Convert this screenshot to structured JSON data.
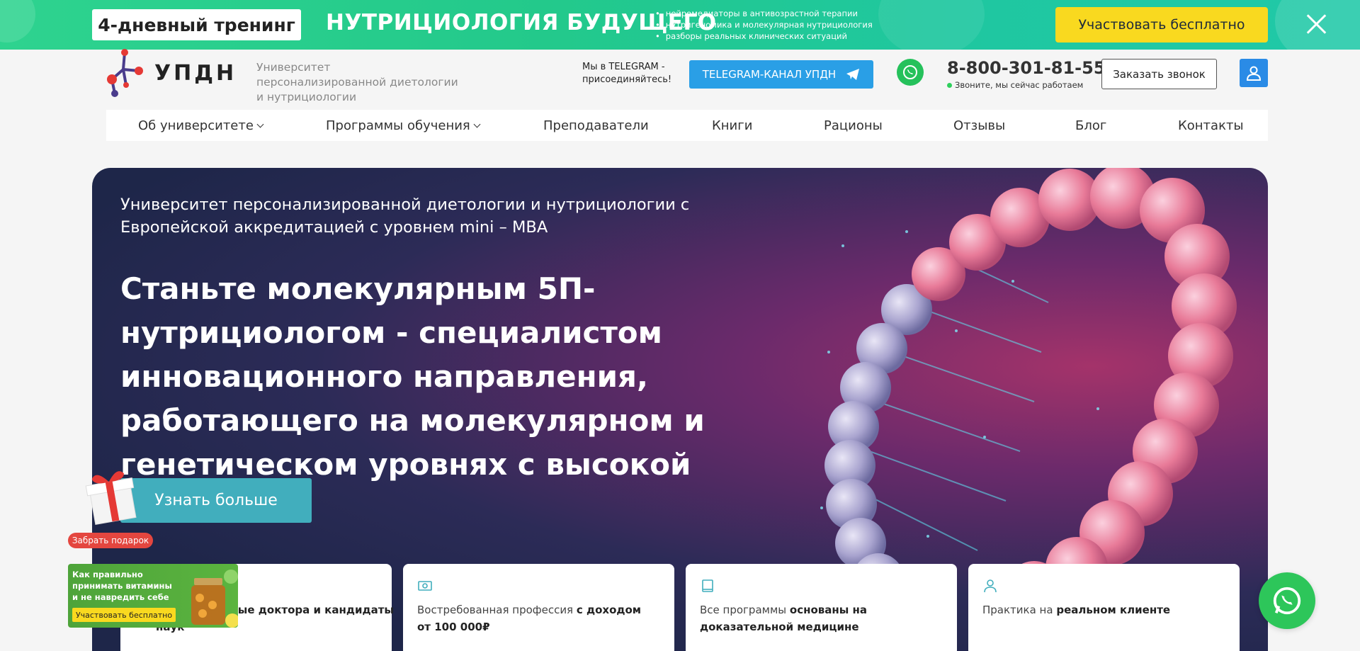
{
  "promo": {
    "pill_label": "4-дневный тренинг",
    "title": "НУТРИЦИОЛОГИЯ БУДУЩЕГО",
    "bullets": [
      "нейромедиаторы в антивозрастной терапии",
      "нутригеномика и молекулярная нутрициология",
      "разборы реальных клинических ситуаций"
    ],
    "cta_label": "Участвовать бесплатно",
    "accent": "#23c98b",
    "cta_color": "#f9d91f"
  },
  "header": {
    "logo_text": "УПДН",
    "tagline": "Университет персонализированной диетологии и нутрициологии",
    "telegram_label": "Мы в TELEGRAM - присоединяйтесь!",
    "telegram_button": "TELEGRAM-КАНАЛ УПДН",
    "phone": "8-800-301-81-55",
    "phone_status": "Звоните, мы сейчас работаем",
    "call_button": "Заказать звонок"
  },
  "nav": {
    "items": [
      {
        "label": "Об университете"
      },
      {
        "label": "Программы обучения"
      },
      {
        "label": "Преподаватели"
      },
      {
        "label": "Книги"
      },
      {
        "label": "Рационы"
      },
      {
        "label": "Отзывы"
      },
      {
        "label": "Блог"
      },
      {
        "label": "Контакты"
      }
    ]
  },
  "hero": {
    "subtitle": "Университет персонализированной диетологии и нутрициологии с Европейской аккредитацией с уровнем mini – MBA",
    "title": "Станьте молекулярным 5П-нутрициологом - специалистом инновационного направления, работающего на молекулярном и генетическом уровнях с высокой точностью",
    "cta_label": "Узнать больше"
  },
  "features": [
    {
      "plain": "",
      "bold": "пломированные доктора и кандидаты наук",
      "icon": "diploma-icon"
    },
    {
      "plain": "Востребованная профессия ",
      "bold": "с доходом от 100 000₽",
      "icon": "money-icon"
    },
    {
      "plain": "Все программы ",
      "bold": "основаны на доказательной медицине",
      "icon": "book-icon"
    },
    {
      "plain": "Практика на ",
      "bold": "реальном клиенте",
      "icon": "user-icon"
    }
  ],
  "gift": {
    "label": "Забрать подарок"
  },
  "vitamin_widget": {
    "text": "Как правильно принимать витамины и не навредить себе",
    "button": "Участвовать бесплатно"
  }
}
